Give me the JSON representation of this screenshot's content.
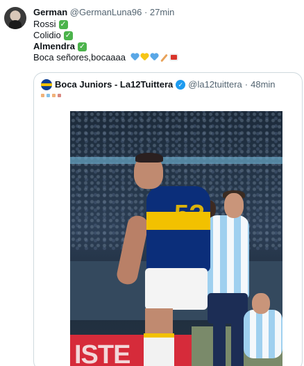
{
  "tweet": {
    "author_name": "German",
    "author_handle": "@GermanLuna96",
    "separator": "·",
    "time": "27min",
    "lines": [
      {
        "text": "Rossi",
        "check": "✓"
      },
      {
        "text": "Colidio",
        "check": "✓"
      },
      {
        "text": "Almendra",
        "check": "✓"
      },
      {
        "text": "Boca señores,bocaaaa"
      }
    ],
    "emoji_icons": [
      "blue-heart-icon",
      "yellow-heart-icon",
      "blue-heart-icon",
      "baseball-bat-icon",
      "drum-icon"
    ],
    "colors": {
      "blue_heart": "#5aa7e6",
      "yellow_heart": "#f5c518"
    }
  },
  "quoted": {
    "author_name": "Boca Juniors - La12Tuittera",
    "verified_mark": "✓",
    "author_handle": "@la12tuittera",
    "separator": "·",
    "time": "48min",
    "media": {
      "type": "photo",
      "ad_board_text": "ISTE",
      "jersey_number": "5?"
    }
  }
}
